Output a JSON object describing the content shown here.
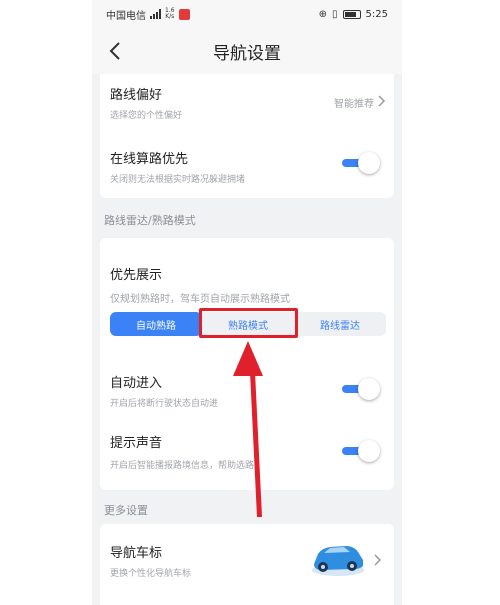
{
  "status_bar": {
    "carrier": "中国电信",
    "net_speed_value": "1.6",
    "net_speed_unit": "K/s",
    "time": "5:25"
  },
  "header": {
    "title": "导航设置",
    "back_icon": "chevron-left-icon"
  },
  "route_card": {
    "preference": {
      "title": "路线偏好",
      "subtitle": "选择您的个性偏好",
      "value": "智能推荐"
    },
    "online_calc": {
      "title": "在线算路优先",
      "subtitle": "关闭则无法根据实时路况躲避拥堵",
      "enabled": true
    }
  },
  "section_radar": "路线雷达/熟路模式",
  "display_card": {
    "title": "优先展示",
    "subtitle": "仅规划熟路时，驾车页自动展示熟路模式",
    "segments": [
      {
        "label": "自动熟路",
        "active": true
      },
      {
        "label": "熟路模式",
        "active": false
      },
      {
        "label": "路线雷达",
        "active": false
      }
    ],
    "auto_enter": {
      "title": "自动进入",
      "subtitle": "开启后将断行驶状态自动进",
      "enabled": true
    },
    "voice": {
      "title": "提示声音",
      "subtitle": "开启后智能播报路境信息，帮助选路",
      "enabled": true
    }
  },
  "section_more": "更多设置",
  "more_card": {
    "car_icon": {
      "title": "导航车标",
      "subtitle": "更换个性化导航车标"
    }
  },
  "colors": {
    "accent": "#3b82f6",
    "annotation": "#e0202a"
  }
}
